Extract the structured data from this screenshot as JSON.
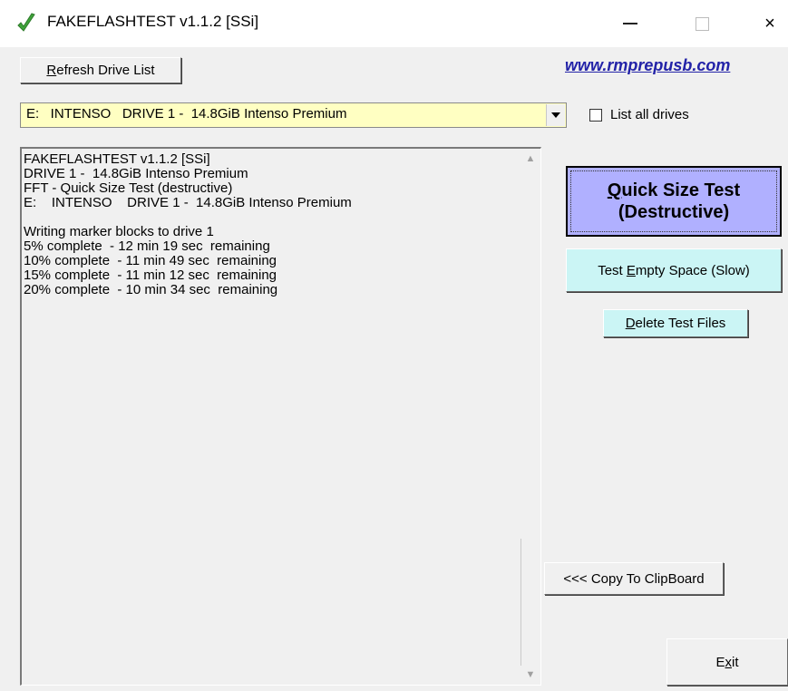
{
  "window": {
    "title": "FAKEFLASHTEST v1.1.2  [SSi]",
    "icon": "green-checkmark-icon",
    "controls": {
      "minimize": "minimize-icon",
      "maximize": "maximize-icon",
      "close": "×"
    }
  },
  "toolbar": {
    "refresh": {
      "access_key": "R",
      "rest": "efresh Drive List"
    },
    "website_link": "www.rmprepusb.com"
  },
  "drive_select": {
    "value": "E:   INTENSO   DRIVE 1 -  14.8GiB Intenso Premium",
    "arrow": "chevron-down-icon",
    "background_color": "#ffffc2"
  },
  "list_all_drives": {
    "label": "List all drives",
    "checked": false
  },
  "log": {
    "lines": [
      "FAKEFLASHTEST v1.1.2 [SSi]",
      "DRIVE 1 -  14.8GiB Intenso Premium",
      "FFT - Quick Size Test (destructive)",
      "E:    INTENSO    DRIVE 1 -  14.8GiB Intenso Premium",
      "",
      "Writing marker blocks to drive 1",
      "5% complete  - 12 min 19 sec  remaining",
      "10% complete  - 11 min 49 sec  remaining",
      "15% complete  - 11 min 12 sec  remaining",
      "20% complete  - 10 min 34 sec  remaining"
    ]
  },
  "actions": {
    "quick_size_test": {
      "line1_key": "Q",
      "line1_rest": "uick Size Test",
      "line2": "(Destructive)",
      "color": "#b0b0ff"
    },
    "test_empty_space": {
      "pre": "Test ",
      "key": "E",
      "post": "mpty Space (Slow)",
      "color": "#cbf5f5"
    },
    "delete_test_files": {
      "key": "D",
      "post": "elete Test Files",
      "color": "#cbf5f5"
    },
    "copy_to_clipboard": "<<< Copy To ClipBoard",
    "exit": {
      "pre": "E",
      "key": "x",
      "post": "it"
    }
  }
}
